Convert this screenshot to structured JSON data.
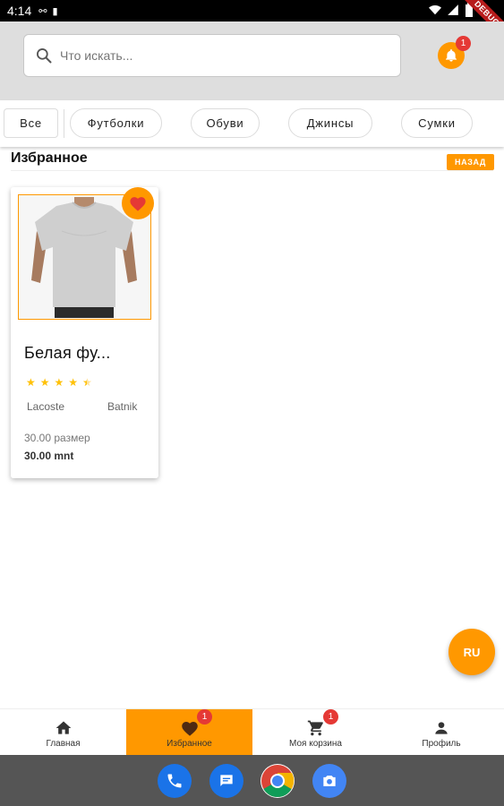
{
  "status_bar": {
    "time": "4:14",
    "debug_label": "DEBUG"
  },
  "search": {
    "placeholder": "Что искать..."
  },
  "notifications": {
    "count": "1"
  },
  "categories": [
    {
      "label": "Все"
    },
    {
      "label": "Футболки"
    },
    {
      "label": "Обуви"
    },
    {
      "label": "Джинсы"
    },
    {
      "label": "Сумки"
    }
  ],
  "section": {
    "title": "Избранное",
    "back_label": "НАЗАД"
  },
  "product": {
    "name": "Белая фу...",
    "rating": 4.5,
    "brand_left": "Lacoste",
    "brand_right": "Batnik",
    "size": "30.00 размер",
    "price": "30.00 mnt",
    "favorite": true
  },
  "language": {
    "label": "RU"
  },
  "bottom_nav": [
    {
      "label": "Главная",
      "icon": "home-icon",
      "badge": ""
    },
    {
      "label": "Избранное",
      "icon": "heart-icon",
      "badge": "1"
    },
    {
      "label": "Моя корзина",
      "icon": "cart-icon",
      "badge": "1"
    },
    {
      "label": "Профиль",
      "icon": "person-icon",
      "badge": ""
    }
  ],
  "dock_apps": [
    "phone-app-icon",
    "messages-app-icon",
    "chrome-app-icon",
    "camera-app-icon"
  ],
  "colors": {
    "accent": "#ff9800",
    "badge": "#e53935",
    "star": "#ffc107",
    "header_bg": "#dedede"
  }
}
